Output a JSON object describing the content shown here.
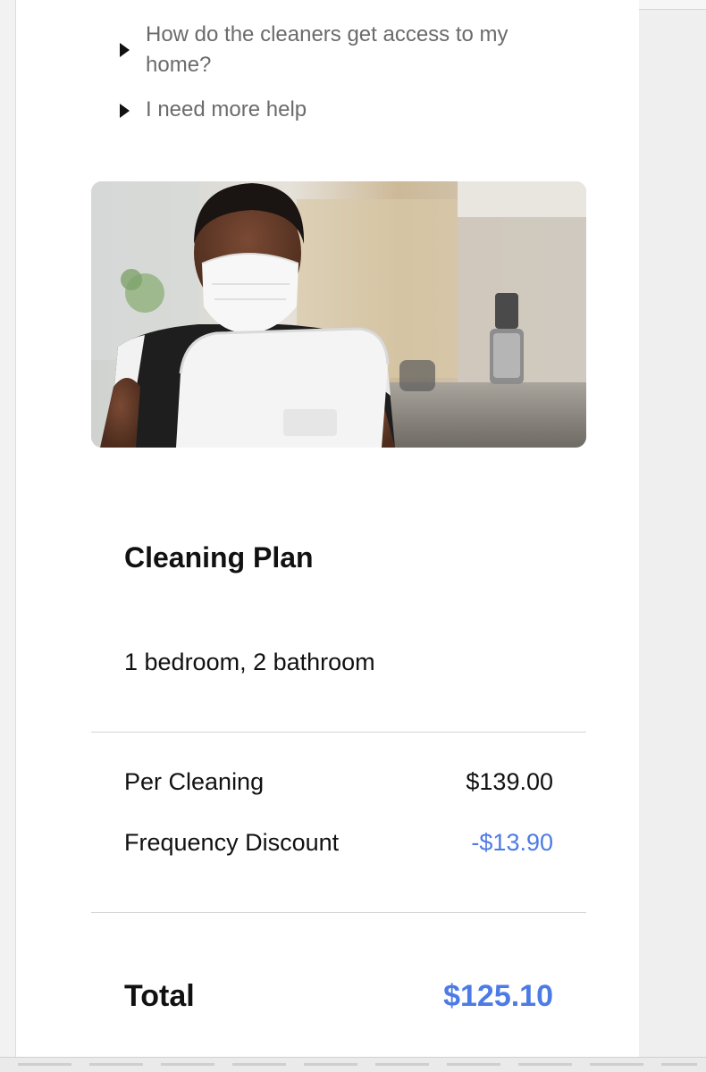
{
  "faq": {
    "items": [
      {
        "question": "How do the cleaners get access to my home?"
      },
      {
        "question": "I need more help"
      }
    ]
  },
  "hero_image": {
    "description_icon": "photo-icon"
  },
  "plan": {
    "title": "Cleaning Plan",
    "description": "1 bedroom, 2 bathroom",
    "rows": [
      {
        "label": "Per Cleaning",
        "value": "$139.00"
      },
      {
        "label": "Frequency Discount",
        "value": "-$13.90"
      }
    ],
    "total_label": "Total",
    "total_value": "$125.10"
  },
  "colors": {
    "accent": "#4d7be6",
    "text": "#111111",
    "muted_text": "#6b6b6b",
    "divider": "#d4d4d4"
  }
}
